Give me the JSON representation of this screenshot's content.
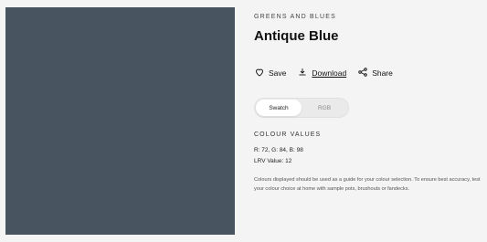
{
  "swatch": {
    "color": "#48545f",
    "name": "Antique Blue swatch"
  },
  "product": {
    "eyebrow": "GREENS AND BLUES",
    "title": "Antique Blue"
  },
  "actions": {
    "save_label": "Save",
    "download_label": "Download",
    "share_label": "Share",
    "save_icon": "heart-icon",
    "download_icon": "download-icon",
    "share_icon": "share-icon"
  },
  "toggle": {
    "options": [
      "Swatch",
      "RGB"
    ],
    "selected": "Swatch"
  },
  "colour_values": {
    "heading": "COLOUR VALUES",
    "rgb_line": "R: 72, G: 84, B: 98",
    "lrv_line": "LRV Value: 12"
  },
  "disclaimer": "Colours displayed should be used as a guide for your colour selection. To ensure best accuracy, test your colour choice at home with sample pots, brushouts or fandecks."
}
